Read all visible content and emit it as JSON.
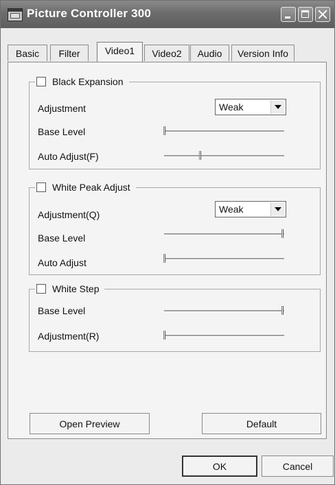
{
  "window": {
    "title": "Picture Controller 300",
    "title_icon": "app-window-icon"
  },
  "tabs": [
    {
      "label": "Basic",
      "active": false
    },
    {
      "label": "Filter",
      "active": false
    },
    {
      "label": "Video1",
      "active": true
    },
    {
      "label": "Video2",
      "active": false
    },
    {
      "label": "Audio",
      "active": false
    },
    {
      "label": "Version Info",
      "active": false
    }
  ],
  "black_expansion": {
    "label": "Black Expansion",
    "checked": false,
    "adjustment_label": "Adjustment",
    "adjustment_value": "Weak",
    "base_level_label": "Base Level",
    "base_level_value": 0.0,
    "auto_adjust_label": "Auto Adjust(F)",
    "auto_adjust_value": 0.3
  },
  "white_peak": {
    "label": "White Peak Adjust",
    "checked": false,
    "adjustment_label": "Adjustment(Q)",
    "adjustment_value": "Weak",
    "base_level_label": "Base Level",
    "base_level_value": 1.0,
    "auto_adjust_label": "Auto Adjust",
    "auto_adjust_value": 0.0
  },
  "white_step": {
    "label": "White Step",
    "checked": false,
    "base_level_label": "Base Level",
    "base_level_value": 1.0,
    "adjustment_label": "Adjustment(R)",
    "adjustment_value": 0.0
  },
  "buttons": {
    "open_preview": "Open Preview",
    "default": "Default",
    "ok": "OK",
    "cancel": "Cancel"
  }
}
